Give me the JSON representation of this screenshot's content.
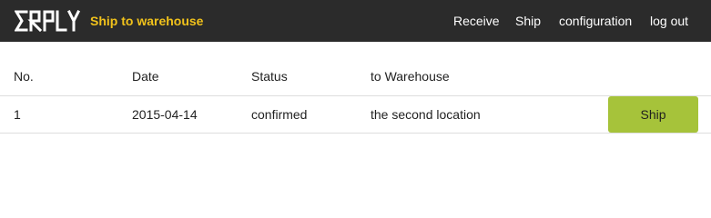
{
  "header": {
    "logo_text": "ERPLY",
    "page_title": "Ship to warehouse",
    "nav": {
      "receive": "Receive",
      "ship": "Ship",
      "configuration": "configuration",
      "logout": "log out"
    },
    "colors": {
      "bar": "#2b2b2b",
      "title": "#f1c21b",
      "nav_text": "#ffffff"
    }
  },
  "table": {
    "columns": [
      "No.",
      "Date",
      "Status",
      "to Warehouse"
    ],
    "rows": [
      {
        "no": "1",
        "date": "2015-04-14",
        "status": "confirmed",
        "warehouse": "the second location",
        "action_label": "Ship"
      }
    ],
    "colors": {
      "action_button": "#a6c33a"
    }
  }
}
